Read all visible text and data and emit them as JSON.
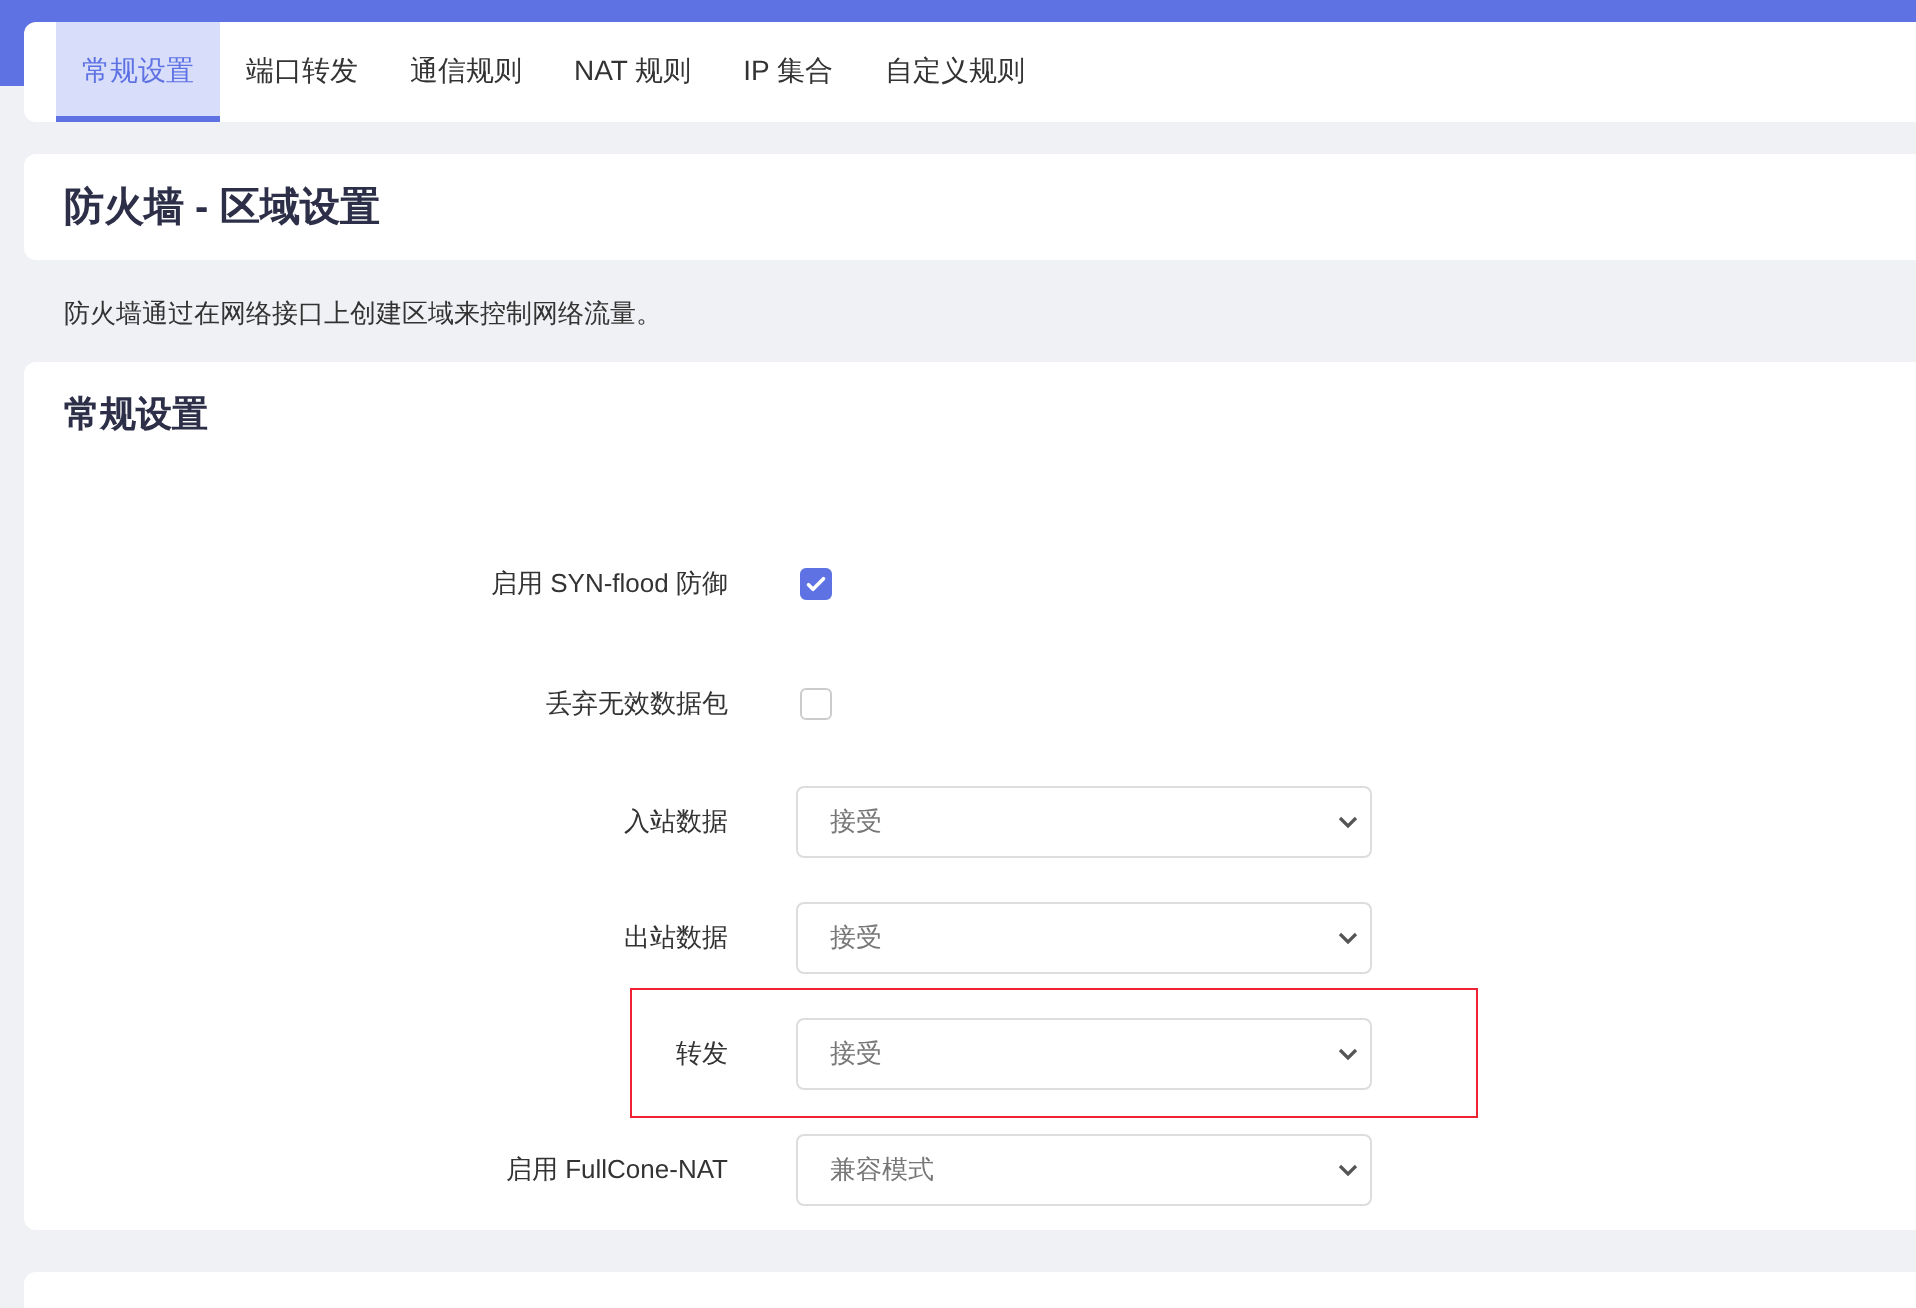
{
  "tabs": [
    {
      "label": "常规设置",
      "selected": true
    },
    {
      "label": "端口转发",
      "selected": false
    },
    {
      "label": "通信规则",
      "selected": false
    },
    {
      "label": "NAT 规则",
      "selected": false
    },
    {
      "label": "IP 集合",
      "selected": false
    },
    {
      "label": "自定义规则",
      "selected": false
    }
  ],
  "page_title": "防火墙 - 区域设置",
  "description": "防火墙通过在网络接口上创建区域来控制网络流量。",
  "section": {
    "title": "常规设置",
    "rows": [
      {
        "kind": "checkbox",
        "label": "启用 SYN-flood 防御",
        "checked": true,
        "highlighted": false
      },
      {
        "kind": "checkbox",
        "label": "丢弃无效数据包",
        "checked": false,
        "highlighted": false
      },
      {
        "kind": "select",
        "label": "入站数据",
        "value": "接受",
        "highlighted": false
      },
      {
        "kind": "select",
        "label": "出站数据",
        "value": "接受",
        "highlighted": false
      },
      {
        "kind": "select",
        "label": "转发",
        "value": "接受",
        "highlighted": true
      },
      {
        "kind": "select",
        "label": "启用 FullCone-NAT",
        "value": "兼容模式",
        "highlighted": false
      }
    ]
  }
}
